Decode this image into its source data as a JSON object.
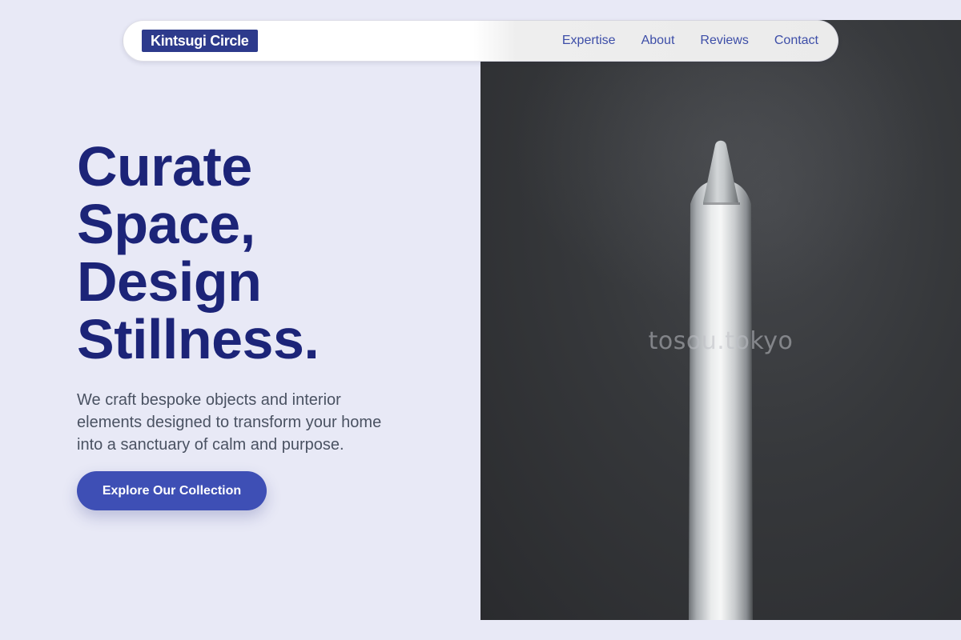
{
  "brand": {
    "name": "Kintsugi Circle"
  },
  "nav": {
    "items": [
      {
        "label": "Expertise"
      },
      {
        "label": "About"
      },
      {
        "label": "Reviews"
      },
      {
        "label": "Contact"
      }
    ]
  },
  "hero": {
    "headline_lines": [
      "Curate",
      "Space,",
      "Design",
      "Stillness."
    ],
    "subtext": "We craft bespoke objects and interior elements designed to transform your home into a sanctuary of calm and purpose.",
    "cta_label": "Explore Our Collection",
    "image_watermark": "tosou.tokyo"
  },
  "colors": {
    "background": "#e8e9f6",
    "brand_bg": "#2d3a8c",
    "headline": "#1c2478",
    "nav_link": "#3d4ea8",
    "cta_bg": "#3e4fb5",
    "body_text": "#4a5262"
  },
  "icons": {
    "hero_image_subject": "stylus-pen"
  }
}
